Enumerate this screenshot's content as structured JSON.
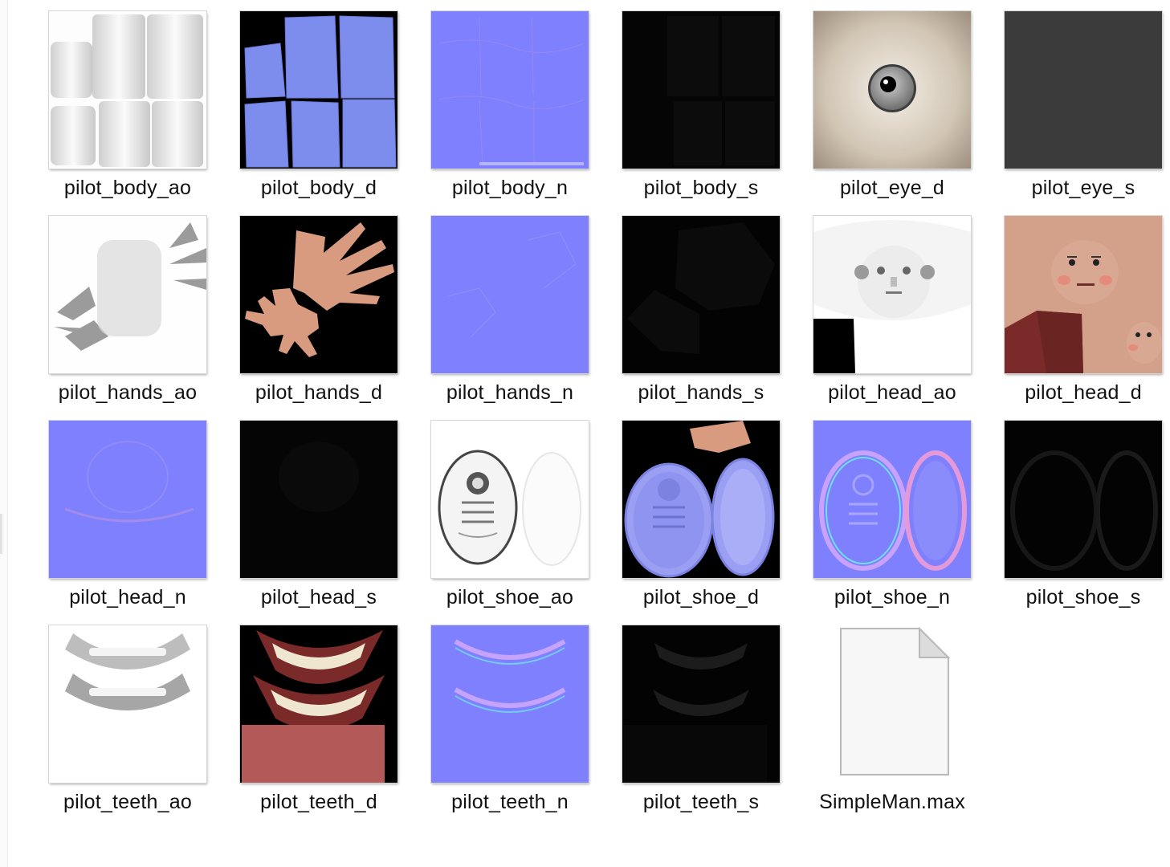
{
  "files": [
    {
      "name": "pilot_body_ao",
      "icon": "texture-ao-thumbnail"
    },
    {
      "name": "pilot_body_d",
      "icon": "texture-diffuse-thumbnail"
    },
    {
      "name": "pilot_body_n",
      "icon": "texture-normal-thumbnail"
    },
    {
      "name": "pilot_body_s",
      "icon": "texture-specular-thumbnail"
    },
    {
      "name": "pilot_eye_d",
      "icon": "eye-texture-thumbnail"
    },
    {
      "name": "pilot_eye_s",
      "icon": "texture-specular-thumbnail"
    },
    {
      "name": "pilot_hands_ao",
      "icon": "texture-ao-thumbnail"
    },
    {
      "name": "pilot_hands_d",
      "icon": "hands-texture-thumbnail"
    },
    {
      "name": "pilot_hands_n",
      "icon": "texture-normal-thumbnail"
    },
    {
      "name": "pilot_hands_s",
      "icon": "texture-specular-thumbnail"
    },
    {
      "name": "pilot_head_ao",
      "icon": "face-ao-thumbnail"
    },
    {
      "name": "pilot_head_d",
      "icon": "face-texture-thumbnail"
    },
    {
      "name": "pilot_head_n",
      "icon": "texture-normal-thumbnail"
    },
    {
      "name": "pilot_head_s",
      "icon": "texture-specular-thumbnail"
    },
    {
      "name": "pilot_shoe_ao",
      "icon": "shoe-ao-thumbnail"
    },
    {
      "name": "pilot_shoe_d",
      "icon": "shoe-texture-thumbnail"
    },
    {
      "name": "pilot_shoe_n",
      "icon": "shoe-normal-thumbnail"
    },
    {
      "name": "pilot_shoe_s",
      "icon": "texture-specular-thumbnail"
    },
    {
      "name": "pilot_teeth_ao",
      "icon": "teeth-ao-thumbnail"
    },
    {
      "name": "pilot_teeth_d",
      "icon": "teeth-texture-thumbnail"
    },
    {
      "name": "pilot_teeth_n",
      "icon": "teeth-normal-thumbnail"
    },
    {
      "name": "pilot_teeth_s",
      "icon": "texture-specular-thumbnail"
    },
    {
      "name": "SimpleMan.max",
      "icon": "blank-file-icon"
    }
  ],
  "colors": {
    "normal_map": "#7f80fe",
    "diffuse_body": "#7d8ded",
    "skin": "#d89b80",
    "gums": "#7a2a28",
    "specular_dark": "#050505",
    "eye_gray": "#3b3b3b"
  }
}
